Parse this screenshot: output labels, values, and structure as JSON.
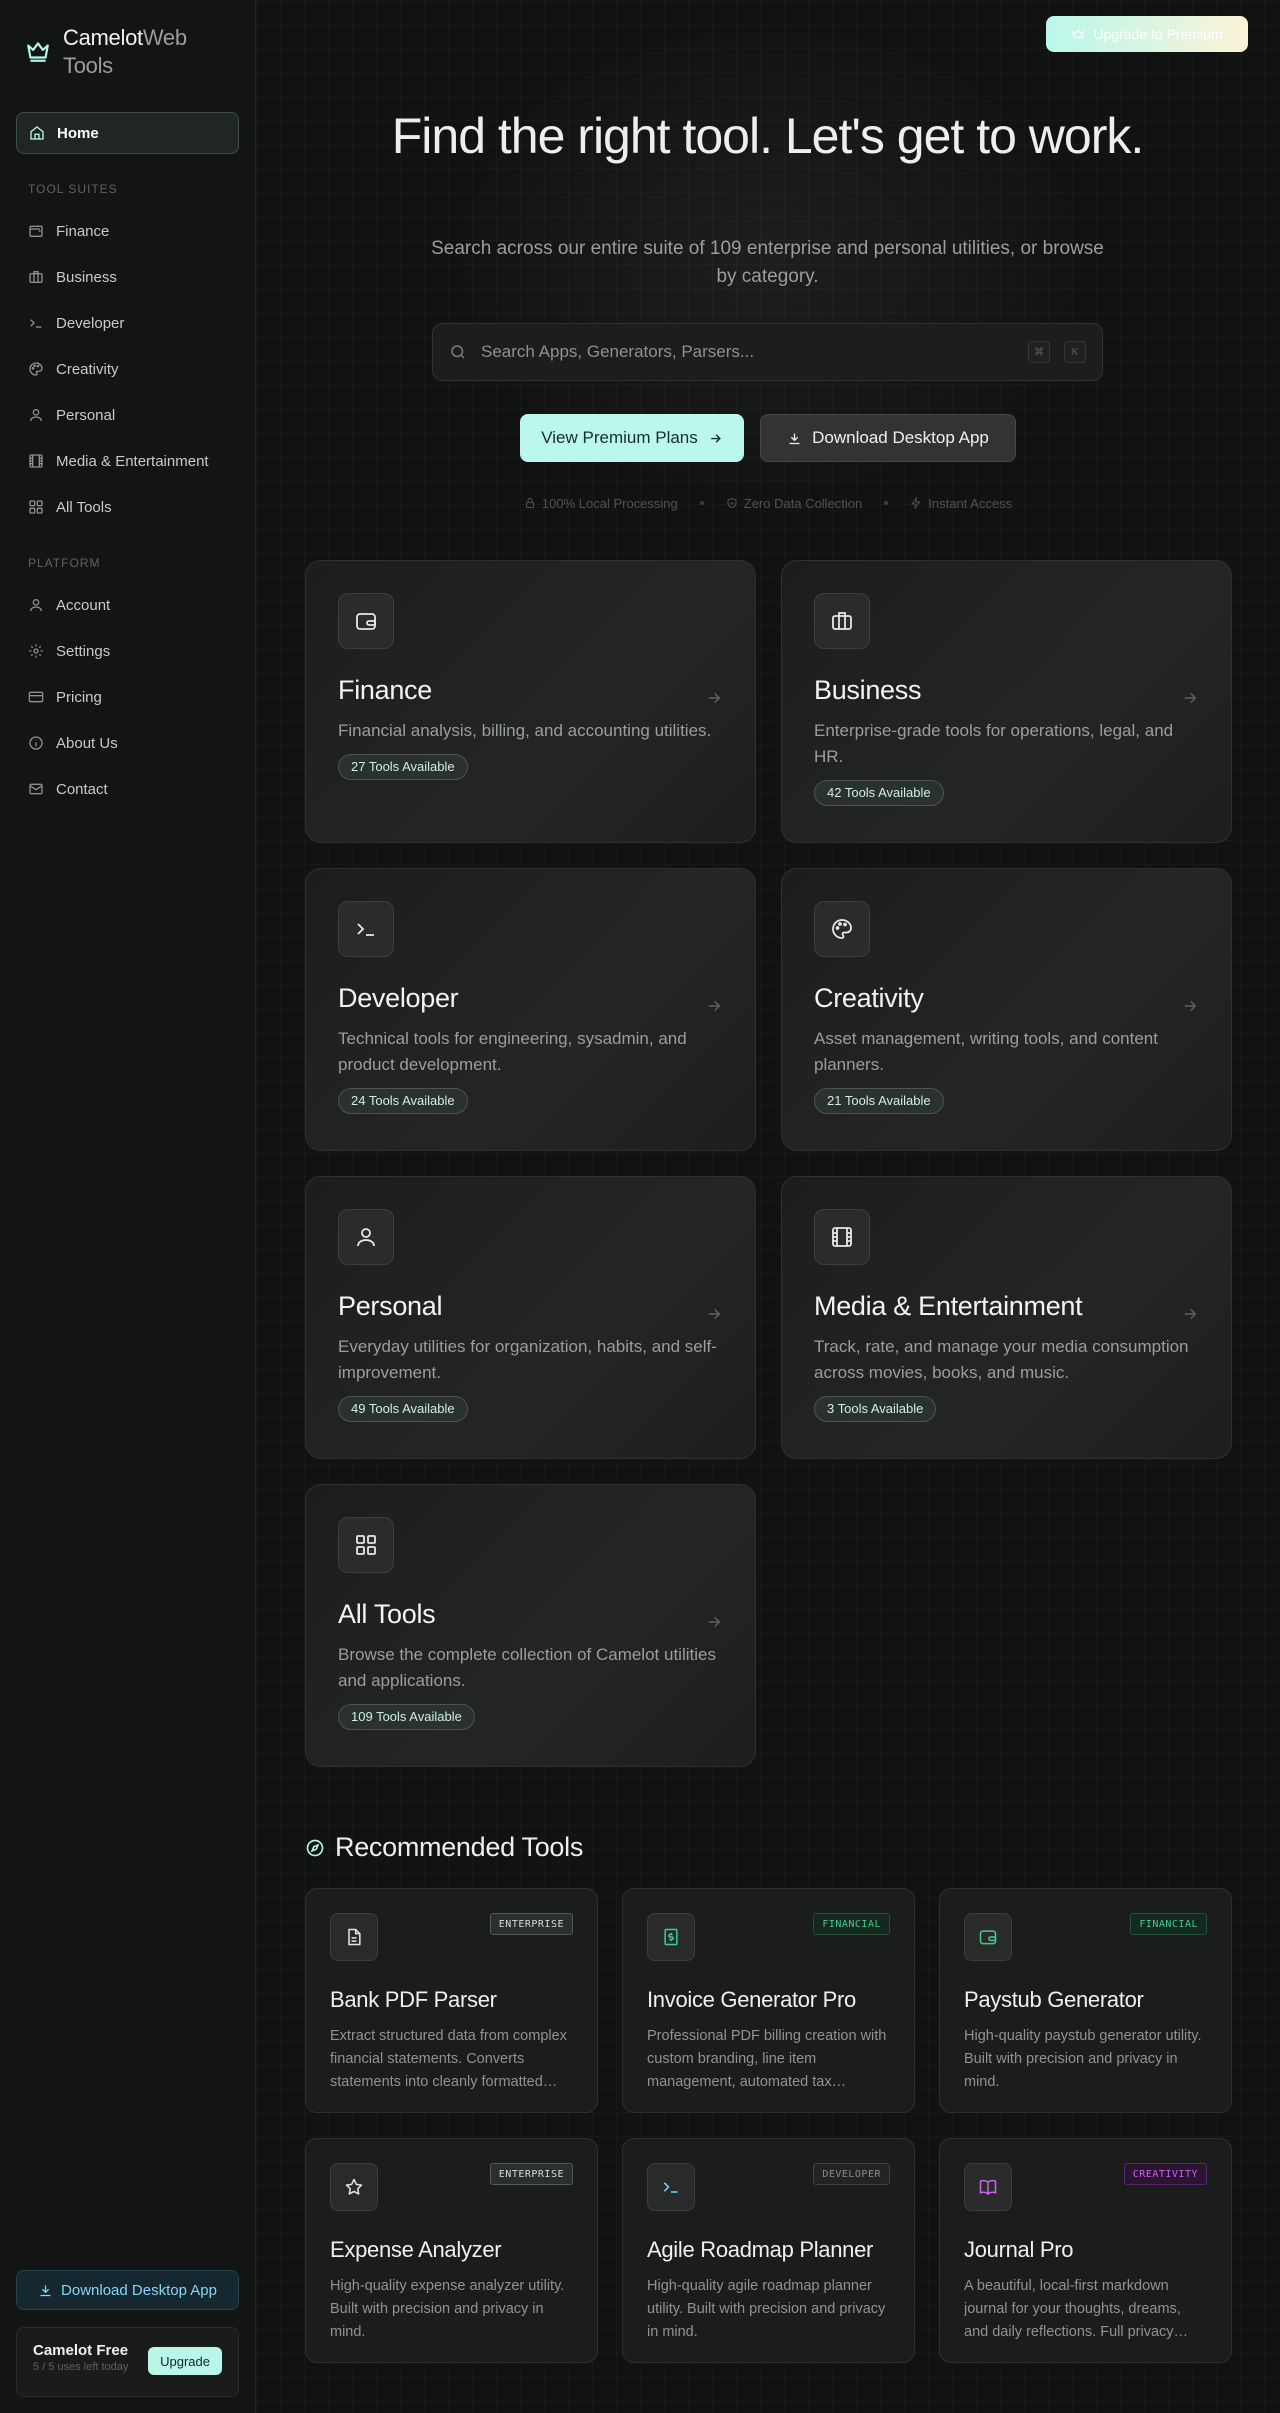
{
  "brand": {
    "name_primary": "Camelot",
    "name_secondary": "Web",
    "name_line2": "Tools"
  },
  "nav": {
    "home": "Home",
    "suites_label": "TOOL SUITES",
    "suites": [
      "Finance",
      "Business",
      "Developer",
      "Creativity",
      "Personal",
      "Media & Entertainment",
      "All Tools"
    ],
    "platform_label": "PLATFORM",
    "platform": [
      "Account",
      "Settings",
      "Pricing",
      "About Us",
      "Contact"
    ]
  },
  "sidebar_footer": {
    "download": "Download Desktop App",
    "plan_name": "Camelot Free",
    "plan_uses": "5 / 5 uses left today",
    "upgrade": "Upgrade"
  },
  "topbar": {
    "upgrade": "Upgrade to Premium"
  },
  "hero": {
    "title": "Find the right tool. Let's get to work.",
    "subtitle": "Search across our entire suite of 109 enterprise and personal utilities, or browse by category.",
    "search_placeholder": "Search Apps, Generators, Parsers...",
    "kbd_cmd": "⌘",
    "kbd_key": "K",
    "btn_premium": "View Premium Plans",
    "btn_download": "Download Desktop App",
    "features": [
      "100% Local Processing",
      "Zero Data Collection",
      "Instant Access"
    ]
  },
  "categories": [
    {
      "title": "Finance",
      "desc": "Financial analysis, billing, and accounting utilities.",
      "badge": "27 Tools Available",
      "icon": "wallet-icon"
    },
    {
      "title": "Business",
      "desc": "Enterprise-grade tools for operations, legal, and HR.",
      "badge": "42 Tools Available",
      "icon": "briefcase-icon"
    },
    {
      "title": "Developer",
      "desc": "Technical tools for engineering, sysadmin, and product development.",
      "badge": "24 Tools Available",
      "icon": "terminal-icon"
    },
    {
      "title": "Creativity",
      "desc": "Asset management, writing tools, and content planners.",
      "badge": "21 Tools Available",
      "icon": "palette-icon"
    },
    {
      "title": "Personal",
      "desc": "Everyday utilities for organization, habits, and self-improvement.",
      "badge": "49 Tools Available",
      "icon": "user-icon"
    },
    {
      "title": "Media & Entertainment",
      "desc": "Track, rate, and manage your media consumption across movies, books, and music.",
      "badge": "3 Tools Available",
      "icon": "film-icon"
    },
    {
      "title": "All Tools",
      "desc": "Browse the complete collection of Camelot utilities and applications.",
      "badge": "109 Tools Available",
      "icon": "grid-icon"
    }
  ],
  "recommended": {
    "heading": "Recommended Tools",
    "items": [
      {
        "title": "Bank PDF Parser",
        "tag": "ENTERPRISE",
        "desc": "Extract structured data from complex financial statements. Converts statements into cleanly formatted data.",
        "icon": "file-text-icon"
      },
      {
        "title": "Invoice Generator Pro",
        "tag": "FINANCIAL",
        "desc": "Professional PDF billing creation with custom branding, line item management, automated tax calculations.",
        "icon": "dollar-icon"
      },
      {
        "title": "Paystub Generator",
        "tag": "FINANCIAL",
        "desc": "High-quality paystub generator utility. Built with precision and privacy in mind.",
        "icon": "wallet-icon"
      },
      {
        "title": "Expense Analyzer",
        "tag": "ENTERPRISE",
        "desc": "High-quality expense analyzer utility. Built with precision and privacy in mind.",
        "icon": "star-icon"
      },
      {
        "title": "Agile Roadmap Planner",
        "tag": "DEVELOPER",
        "desc": "High-quality agile roadmap planner utility. Built with precision and privacy in mind.",
        "icon": "terminal-icon"
      },
      {
        "title": "Journal Pro",
        "tag": "CREATIVITY",
        "desc": "A beautiful, local-first markdown journal for your thoughts, dreams, and daily reflections. Full privacy guaranteed.",
        "icon": "book-icon"
      }
    ]
  },
  "colors": {
    "accent": "#b9f5e8",
    "background": "#111212",
    "financial": "#3fcf8b",
    "creativity": "#d061f0"
  }
}
